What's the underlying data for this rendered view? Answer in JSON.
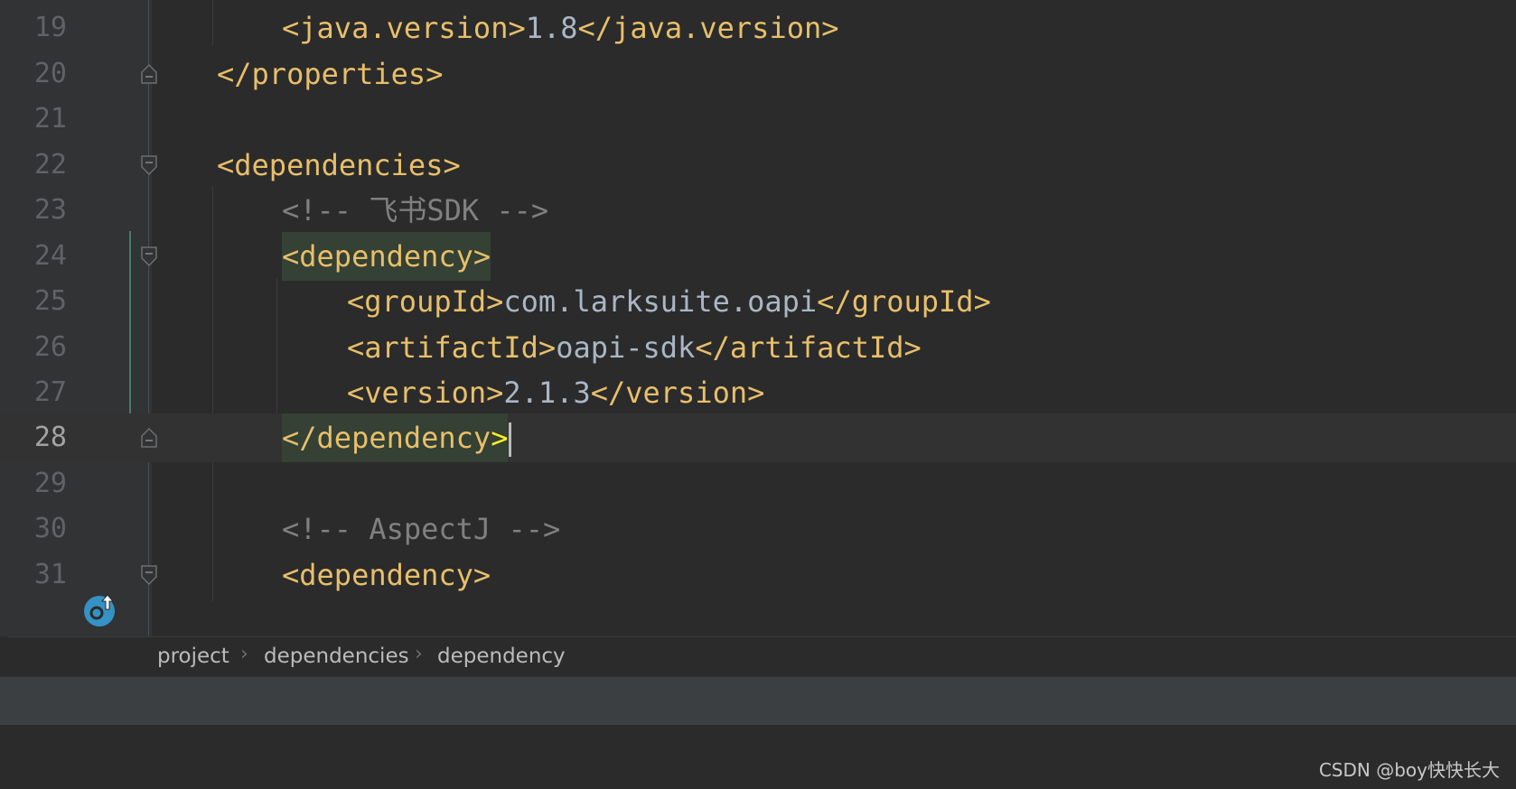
{
  "editor": {
    "current_line": "28",
    "lines": [
      {
        "num": "19",
        "open": "<java.version>",
        "text": "1.8",
        "close": "</java.version>"
      },
      {
        "num": "20",
        "close": "</properties>"
      },
      {
        "num": "21"
      },
      {
        "num": "22",
        "open": "<dependencies>"
      },
      {
        "num": "23",
        "comment": "<!-- 飞书SDK -->"
      },
      {
        "num": "24",
        "open": "<dependency>"
      },
      {
        "num": "25",
        "open": "<groupId>",
        "text": "com.larksuite.oapi",
        "close": "</groupId>"
      },
      {
        "num": "26",
        "open": "<artifactId>",
        "text": "oapi-sdk",
        "close": "</artifactId>"
      },
      {
        "num": "27",
        "open": "<version>",
        "text": "2.1.3",
        "close": "</version>"
      },
      {
        "num": "28",
        "close_a": "</dependency",
        "close_b": ">"
      },
      {
        "num": "29"
      },
      {
        "num": "30",
        "comment": "<!-- AspectJ -->"
      },
      {
        "num": "31",
        "open": "<dependency>"
      }
    ]
  },
  "gutter": {
    "override_icon": "override-method-icon",
    "fold_icon": "fold-marker-icon"
  },
  "breadcrumb": {
    "items": [
      "project",
      "dependencies",
      "dependency"
    ],
    "separator": "›"
  },
  "watermark": "CSDN @boy快快长大",
  "colors": {
    "background": "#2b2b2b",
    "tag": "#e8bf6a",
    "text": "#a9b7c6",
    "comment": "#808080",
    "match_highlight": "#344134",
    "bracket_highlight": "#ffef28"
  }
}
